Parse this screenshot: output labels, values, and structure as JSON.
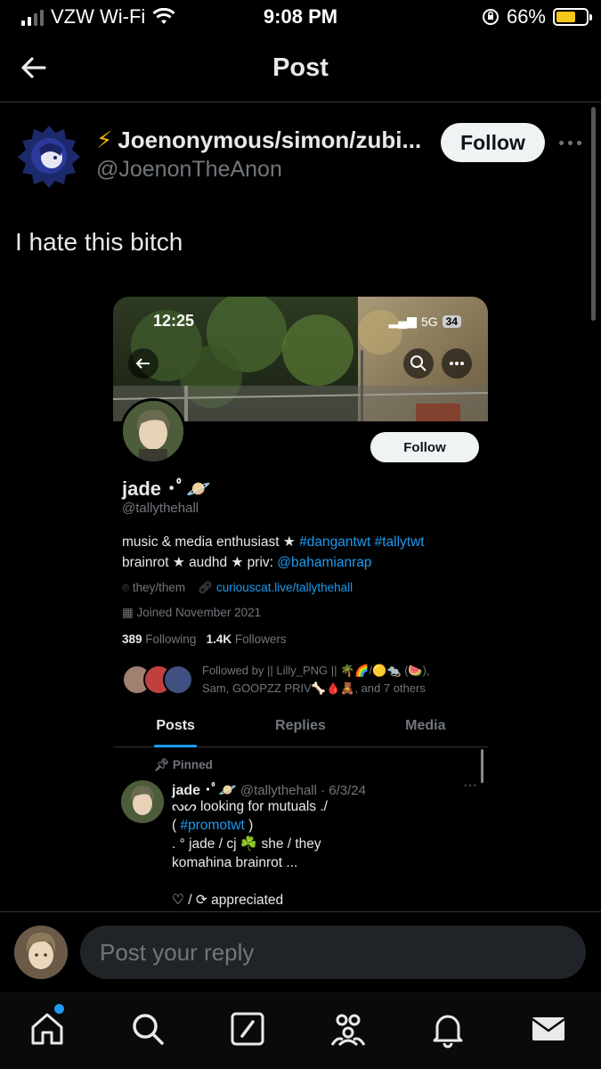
{
  "status_bar": {
    "carrier": "VZW Wi-Fi",
    "time": "9:08 PM",
    "battery": "66%",
    "battery_level": 0.66
  },
  "header": {
    "back_icon": "arrow-left-icon",
    "title": "Post"
  },
  "post": {
    "author_name": "Joenonymous/simon/zubi...",
    "author_name_prefix": "⚡",
    "author_handle": "@JoenonTheAnon",
    "follow_label": "Follow",
    "text": "I hate this bitch"
  },
  "embed": {
    "time": "12:25",
    "network": "5G",
    "battery": "34",
    "follow_label": "Follow",
    "name": "jade ･ﾟ🪐",
    "handle": "@tallythehall",
    "bio_line1_text": "music & media enthusiast ★ ",
    "bio_line1_tags": "#dangantwt #tallytwt",
    "bio_line2_text": "brainrot ★ audhd ★ priv: ",
    "bio_line2_link": "@bahamianrap",
    "pronouns": "they/them",
    "website": "curiouscat.live/tallythehall",
    "joined": "Joined November 2021",
    "following_count": "389",
    "following_label": "Following",
    "followers_count": "1.4K",
    "followers_label": "Followers",
    "followed_by_line1": "Followed by || Lilly_PNG || 🌴🌈/🟡🐀 (🍉),",
    "followed_by_line2": "Sam, GOOPZZ PRIV🦴🩸🧸, and 7 others",
    "tabs": [
      "Posts",
      "Replies",
      "Media"
    ],
    "pinned_label": "Pinned",
    "pinned_name": "jade ･ﾟ🪐",
    "pinned_meta": "@tallythehall · 6/3/24",
    "pinned_line1": "ᔓᔕ looking for mutuals ./",
    "pinned_line2_open": "( ",
    "pinned_line2_tag": "#promotwt",
    "pinned_line2_close": " )",
    "pinned_line3": ". ° jade / cj ☘️ she / they",
    "pinned_line4": "komahina brainrot ...",
    "pinned_line5": "♡ / ⟳ appreciated"
  },
  "reply": {
    "placeholder": "Post your reply"
  },
  "nav": {
    "items": [
      "home-icon",
      "search-icon",
      "compose-icon",
      "communities-icon",
      "notifications-icon",
      "messages-icon"
    ]
  },
  "colors": {
    "accent": "#1d9bf0",
    "background": "#000000",
    "text": "#e7e9ea",
    "muted": "#71767b"
  }
}
